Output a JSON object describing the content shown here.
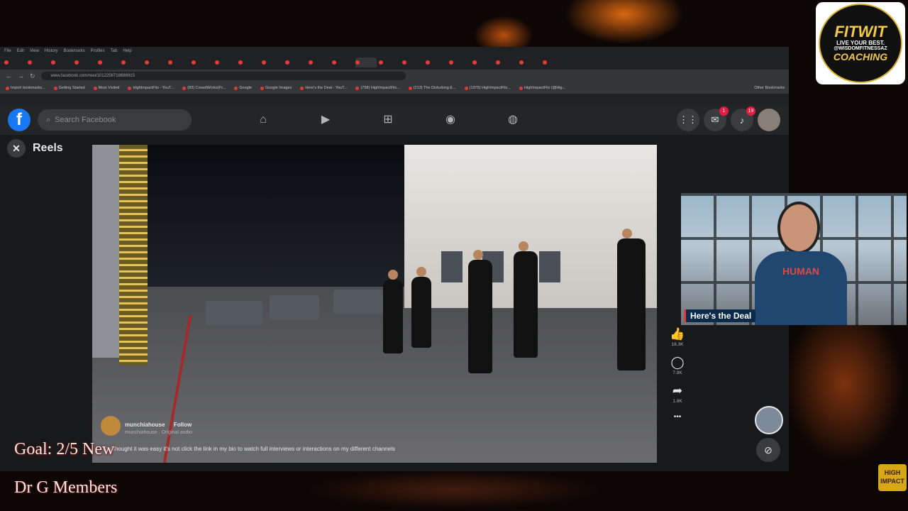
{
  "browser": {
    "menu": [
      "File",
      "Edit",
      "View",
      "History",
      "Bookmarks",
      "Profiles",
      "Tab",
      "Help"
    ],
    "tabs_count": 24,
    "url": "www.facebook.com/reel/1012256718686915",
    "bookmarks": [
      "Import bookmarks...",
      "Getting Started",
      "Most Visited",
      "HighImpactFlix - YouT...",
      "(83) CrowdWorks(Fr...",
      "Google",
      "Google Images",
      "Here's the Deal - YouT...",
      "(758) HighImpactFlix...",
      "(213) The Disturbing E...",
      "(1375) HighImpactFlix...",
      "HighImpactFlix (@Hig..."
    ],
    "other_bookmarks": "Other Bookmarks"
  },
  "facebook": {
    "logo": "f",
    "search_placeholder": "Search Facebook",
    "nav_icons": [
      "home-icon",
      "video-icon",
      "marketplace-icon",
      "groups-icon",
      "gaming-icon"
    ],
    "messenger_badge": "1",
    "notifications_badge": "19"
  },
  "reels": {
    "title": "Reels",
    "username": "munchiahouse",
    "follow": "Follow",
    "audio": "munchiahouse · Original audio",
    "caption": "You thought it was easy it's not click the link in my bio to watch full interviews or interactions on my different channels",
    "likes": "18.3K",
    "comments": "7.8K",
    "shares": "1.8K",
    "more": "•••"
  },
  "webcam": {
    "label": "Here's the Deal",
    "shirt_text": "HUMAN"
  },
  "overlay": {
    "goal_line1": "Goal: 2/5 New",
    "goal_line2": "Dr G Members",
    "fitwit_name": "FITWIT",
    "fitwit_tagline": "LIVE YOUR BEST.",
    "fitwit_handle": "@WISDOMFITNESSAZ",
    "fitwit_coaching": "COACHING",
    "hm_logo": "HIGH IMPACT"
  },
  "colors": {
    "fb_blue": "#1877f2",
    "badge_red": "#e41e3f",
    "fitwit_gold": "#f2c94c"
  }
}
